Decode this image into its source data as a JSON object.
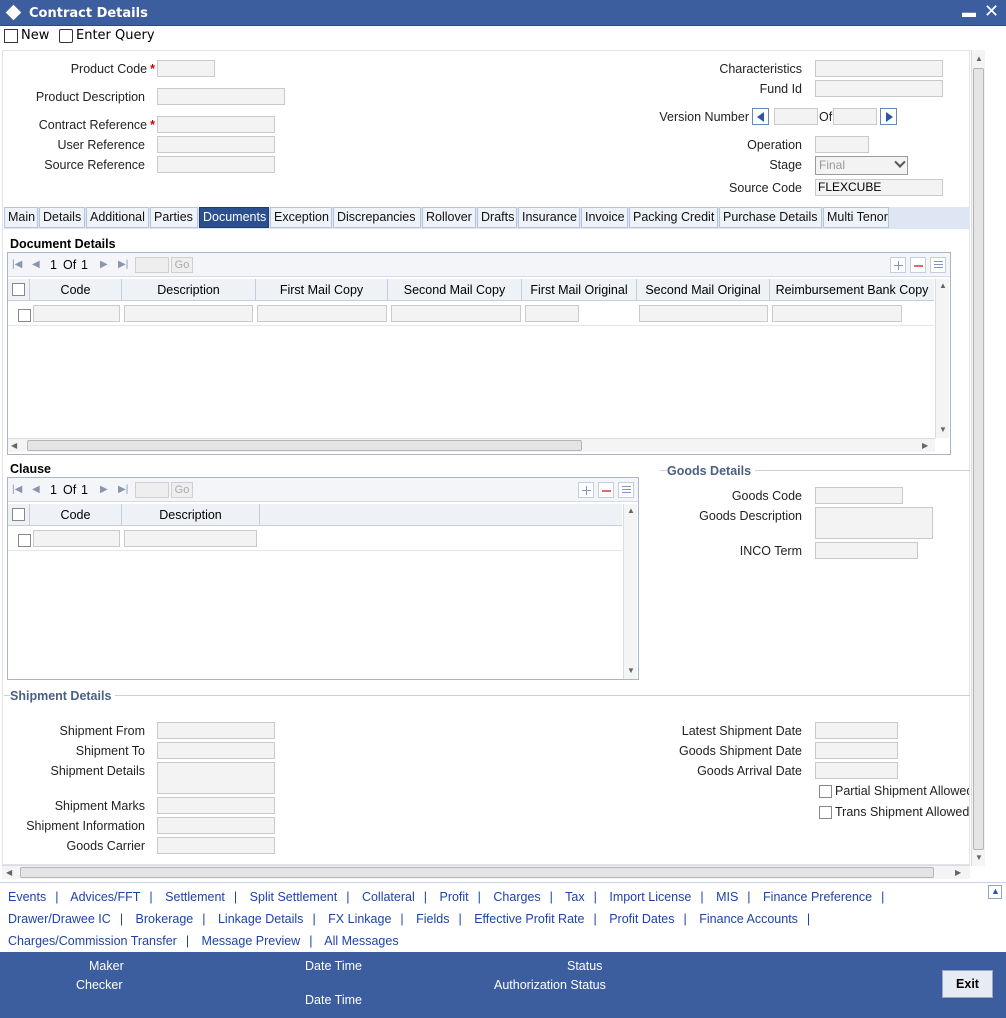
{
  "window": {
    "title": "Contract Details"
  },
  "toolbar": {
    "new_label": "New",
    "enter_query_label": "Enter Query"
  },
  "header": {
    "product_code_label": "Product Code",
    "product_description_label": "Product Description",
    "contract_reference_label": "Contract Reference",
    "user_reference_label": "User Reference",
    "source_reference_label": "Source Reference",
    "required_mark": "*",
    "characteristics_label": "Characteristics",
    "fund_id_label": "Fund Id",
    "version_number_label": "Version Number",
    "of_label": "Of",
    "operation_label": "Operation",
    "stage_label": "Stage",
    "stage_value": "Final",
    "source_code_label": "Source Code",
    "source_code_value": "FLEXCUBE"
  },
  "tabs": [
    {
      "label": "Main"
    },
    {
      "label": "Details"
    },
    {
      "label": "Additional"
    },
    {
      "label": "Parties"
    },
    {
      "label": "Documents"
    },
    {
      "label": "Exception"
    },
    {
      "label": "Discrepancies"
    },
    {
      "label": "Rollover"
    },
    {
      "label": "Drafts"
    },
    {
      "label": "Insurance"
    },
    {
      "label": "Invoice"
    },
    {
      "label": "Packing Credit"
    },
    {
      "label": "Purchase Details"
    },
    {
      "label": "Multi Tenor"
    }
  ],
  "document_details": {
    "title": "Document Details",
    "pager": {
      "current": "1",
      "of": "Of",
      "total": "1",
      "go": "Go"
    },
    "columns": [
      "Code",
      "Description",
      "First Mail Copy",
      "Second Mail Copy",
      "First Mail Original",
      "Second Mail Original",
      "Reimbursement Bank Copy"
    ]
  },
  "clause": {
    "title": "Clause",
    "pager": {
      "current": "1",
      "of": "Of",
      "total": "1",
      "go": "Go"
    },
    "columns": [
      "Code",
      "Description"
    ]
  },
  "goods_details": {
    "title": "Goods Details",
    "goods_code_label": "Goods Code",
    "goods_description_label": "Goods Description",
    "inco_term_label": "INCO Term"
  },
  "shipment_details": {
    "title": "Shipment Details",
    "shipment_from_label": "Shipment From",
    "shipment_to_label": "Shipment To",
    "shipment_details_label": "Shipment Details",
    "shipment_marks_label": "Shipment Marks",
    "shipment_information_label": "Shipment Information",
    "goods_carrier_label": "Goods Carrier",
    "latest_shipment_date_label": "Latest Shipment Date",
    "goods_shipment_date_label": "Goods Shipment Date",
    "goods_arrival_date_label": "Goods Arrival Date",
    "partial_shipment_allowed_label": "Partial Shipment Allowed",
    "trans_shipment_allowed_label": "Trans Shipment Allowed"
  },
  "links": {
    "row1": [
      "Events",
      "Advices/FFT",
      "Settlement",
      "Split Settlement",
      "Collateral",
      "Profit",
      "Charges",
      "Tax",
      "Import License",
      "MIS",
      "Finance Preference"
    ],
    "row2": [
      "Drawer/Drawee IC",
      "Brokerage",
      "Linkage Details",
      "FX Linkage",
      "Fields",
      "Effective Profit Rate",
      "Profit Dates",
      "Finance Accounts"
    ],
    "row3": [
      "Charges/Commission Transfer",
      "Message Preview",
      "All Messages"
    ]
  },
  "footer": {
    "maker_label": "Maker",
    "checker_label": "Checker",
    "date_time_label": "Date Time",
    "status_label": "Status",
    "authorization_status_label": "Authorization Status",
    "exit_label": "Exit"
  }
}
